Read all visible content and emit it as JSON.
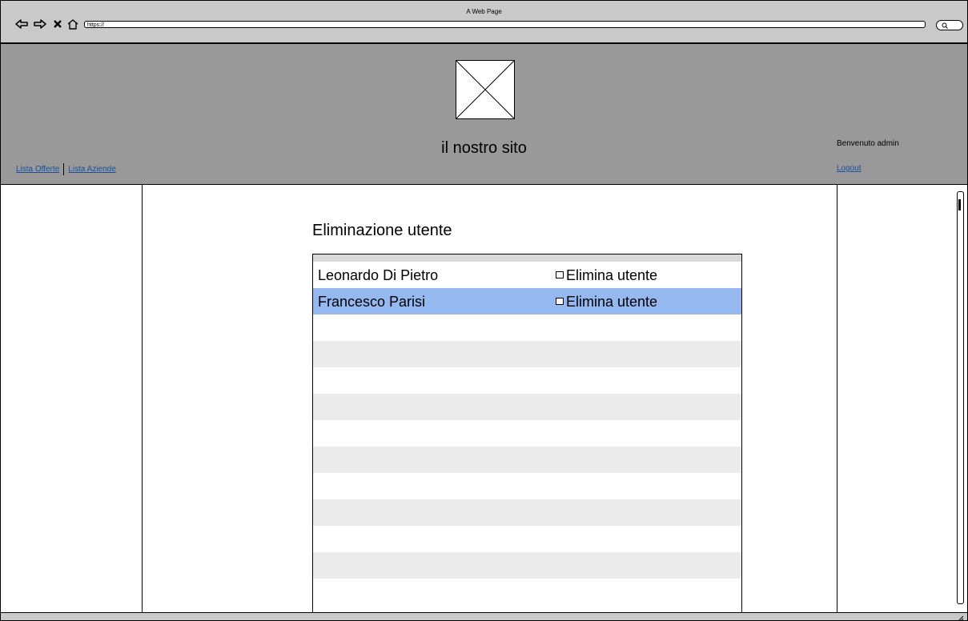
{
  "browser": {
    "title": "A Web Page",
    "url": "https://"
  },
  "header": {
    "site_title": "il nostro sito",
    "nav_links": [
      "Lista Offerte",
      "Lista Aziende"
    ],
    "welcome": "Benvenuto admin",
    "logout": "Logout"
  },
  "main": {
    "heading": "Eliminazione utente",
    "users": [
      {
        "name": "Leonardo Di Pietro",
        "action": "Elimina utente",
        "checked": false,
        "selected": false
      },
      {
        "name": "Francesco Parisi",
        "action": "Elimina utente",
        "checked": false,
        "selected": true
      }
    ]
  },
  "colors": {
    "header_bg": "#999999",
    "selected_row": "#94b8ef",
    "link": "#1a4fa0"
  }
}
